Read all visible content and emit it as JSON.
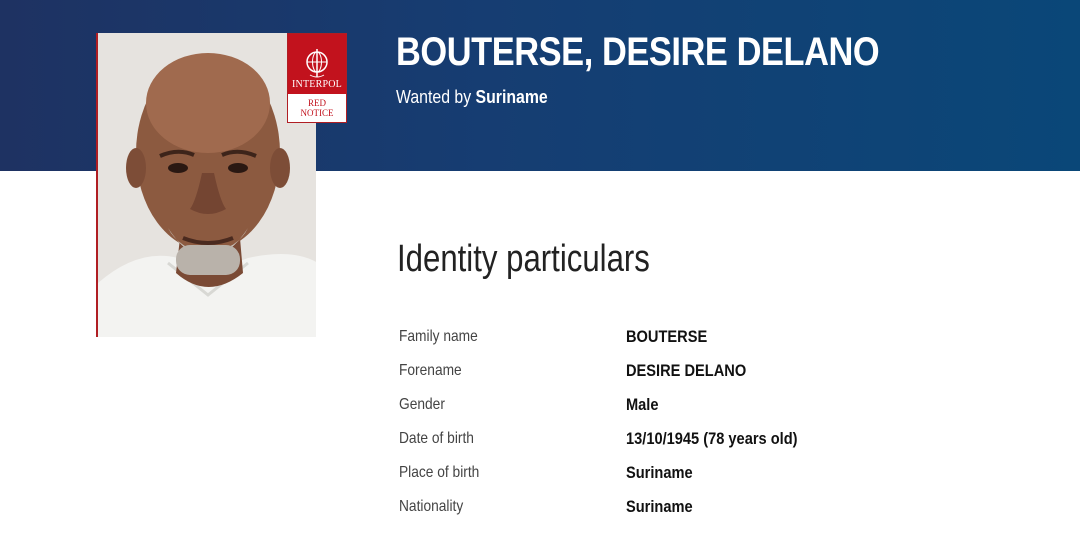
{
  "header": {
    "full_name": "BOUTERSE, DESIRE DELANO",
    "wanted_prefix": "Wanted by",
    "wanted_by": "Suriname"
  },
  "badge": {
    "logo_text": "INTERPOL",
    "notice_line1": "RED",
    "notice_line2": "NOTICE",
    "icon": "interpol-globe-icon"
  },
  "photo": {
    "alt": "Portrait photo"
  },
  "identity": {
    "title": "Identity particulars",
    "rows": [
      {
        "label": "Family name",
        "value": "BOUTERSE"
      },
      {
        "label": "Forename",
        "value": "DESIRE DELANO"
      },
      {
        "label": "Gender",
        "value": "Male"
      },
      {
        "label": "Date of birth",
        "value": "13/10/1945 (78 years old)"
      },
      {
        "label": "Place of birth",
        "value": "Suriname"
      },
      {
        "label": "Nationality",
        "value": "Suriname"
      }
    ]
  },
  "colors": {
    "banner_dark": "#1e3262",
    "banner_light": "#0a4778",
    "notice_red": "#c2121d"
  }
}
